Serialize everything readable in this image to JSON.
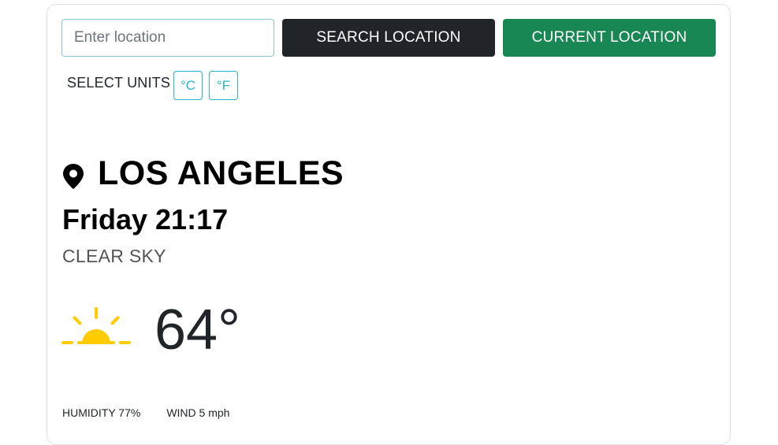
{
  "search": {
    "placeholder": "Enter location",
    "value": "",
    "search_button_label": "SEARCH LOCATION",
    "current_button_label": "CURRENT LOCATION"
  },
  "units": {
    "label": "SELECT UNITS",
    "celsius_label": "°C",
    "fahrenheit_label": "°F"
  },
  "weather": {
    "city": "LOS ANGELES",
    "datetime": "Friday 21:17",
    "condition": "CLEAR SKY",
    "temperature": "64°",
    "humidity": "HUMIDITY 77%",
    "wind": "WIND 5 mph"
  },
  "colors": {
    "search_button": "#212529",
    "current_button": "#198754",
    "unit_accent": "#2ab3c9",
    "sun": "#ffcc00"
  },
  "icons": {
    "location": "map-pin-icon",
    "weather": "sunrise-icon"
  }
}
